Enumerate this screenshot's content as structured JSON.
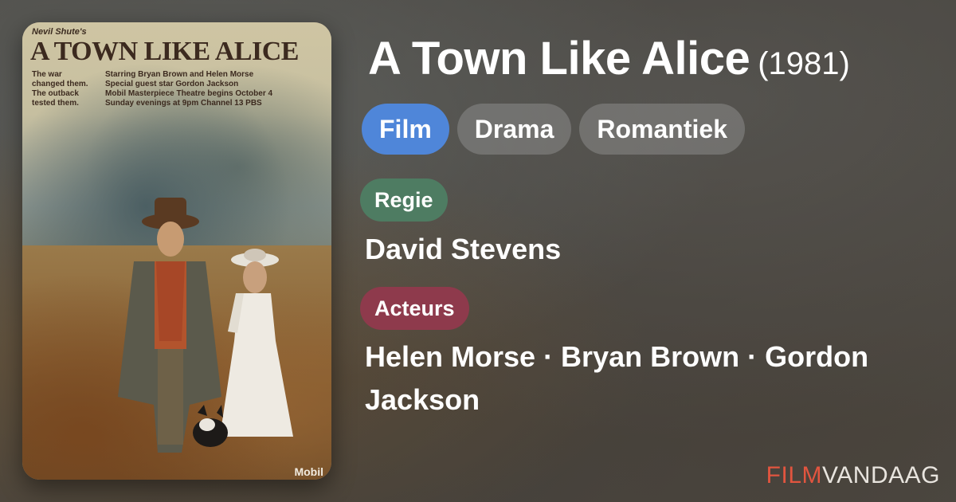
{
  "poster": {
    "small_top": "Nevil Shute's",
    "title": "A TOWN LIKE ALICE",
    "tagline": [
      "The war",
      "changed them.",
      "The outback",
      "tested them."
    ],
    "credits": [
      "Starring Bryan Brown and Helen Morse",
      "Special guest star Gordon Jackson",
      "Mobil Masterpiece Theatre begins October 4",
      "Sunday evenings at 9pm Channel 13 PBS"
    ],
    "sponsor": "Mobil"
  },
  "movie": {
    "title": "A Town Like Alice",
    "year": "(1981)"
  },
  "genres": [
    "Film",
    "Drama",
    "Romantiek"
  ],
  "regie": {
    "label": "Regie",
    "value": "David Stevens"
  },
  "acteurs": {
    "label": "Acteurs",
    "value": "Helen Morse · Bryan Brown · Gordon Jackson"
  },
  "brand": {
    "part1": "FILM",
    "part2": "VANDAAG"
  },
  "colors": {
    "primary_chip": "#4f86d9",
    "regie_badge": "#4e7c62",
    "acteurs_badge": "#8e3a4c",
    "brand_red": "#e2553f"
  }
}
